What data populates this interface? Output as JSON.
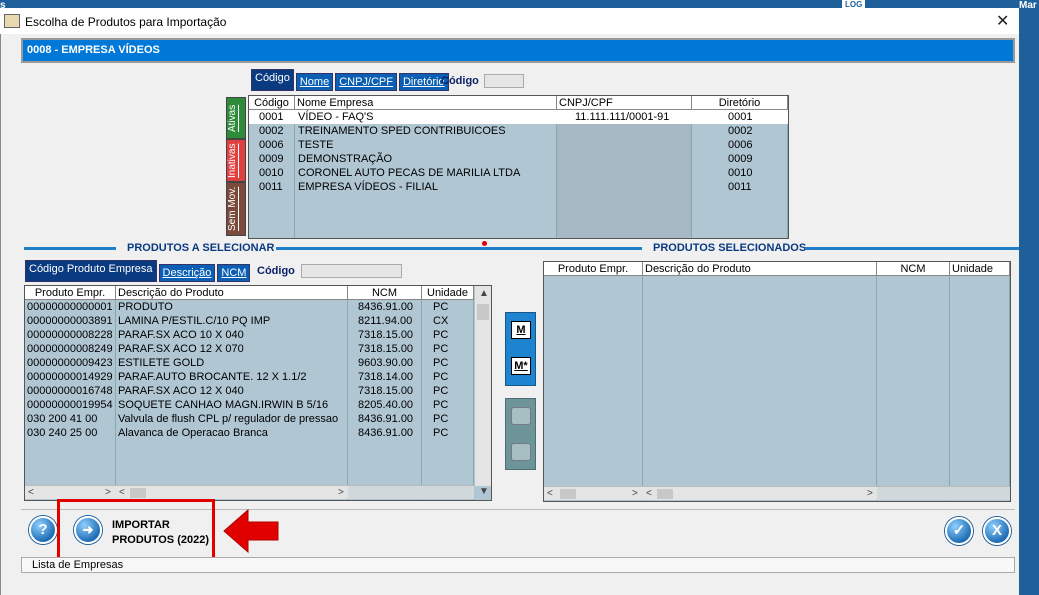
{
  "window": {
    "title": "Escolha de Produtos para Importação",
    "close_glyph": "✕",
    "topbar_left": "s",
    "topbar_right": "Mar",
    "topbar_log": "LOG"
  },
  "company_bar": "0008 - EMPRESA VÍDEOS",
  "company_tabs": {
    "tabs": [
      "Código",
      "Nome",
      "CNPJ/CPF",
      "Diretório"
    ],
    "search_label": "Código"
  },
  "company_vtabs": [
    "Ativas",
    "Inativas",
    "Sem Mov."
  ],
  "company_grid": {
    "headers": [
      "Código",
      "Nome Empresa",
      "CNPJ/CPF",
      "Diretório"
    ],
    "rows": [
      {
        "codigo": "0001",
        "nome": "VÍDEO - FAQ'S",
        "cnpj": "11.111.111/0001-91",
        "dir": "0001"
      },
      {
        "codigo": "0002",
        "nome": "TREINAMENTO SPED CONTRIBUICOES",
        "cnpj": "",
        "dir": "0002"
      },
      {
        "codigo": "0006",
        "nome": "TESTE",
        "cnpj": "",
        "dir": "0006"
      },
      {
        "codigo": "0009",
        "nome": "DEMONSTRAÇÃO",
        "cnpj": "",
        "dir": "0009"
      },
      {
        "codigo": "0010",
        "nome": "CORONEL AUTO PECAS DE MARILIA LTDA",
        "cnpj": "",
        "dir": "0010"
      },
      {
        "codigo": "0011",
        "nome": "EMPRESA VÍDEOS - FILIAL",
        "cnpj": "",
        "dir": "0011"
      }
    ]
  },
  "sections": {
    "left_title": "PRODUTOS A SELECIONAR",
    "right_title": "PRODUTOS SELECIONADOS"
  },
  "product_tabs": {
    "tabs": [
      "Código Produto Empresa",
      "Descrição",
      "NCM"
    ],
    "search_label": "Código"
  },
  "products_grid": {
    "headers": [
      "Produto Empr.",
      "Descrição do Produto",
      "NCM",
      "Unidade"
    ],
    "rows": [
      {
        "cod": "00000000000001",
        "desc": "PRODUTO",
        "ncm": "8436.91.00",
        "un": "PC"
      },
      {
        "cod": "00000000003891",
        "desc": "LAMINA P/ESTIL.C/10 PQ IMP",
        "ncm": "8211.94.00",
        "un": "CX"
      },
      {
        "cod": "00000000008228",
        "desc": "PARAF.SX ACO 10 X 040",
        "ncm": "7318.15.00",
        "un": "PC"
      },
      {
        "cod": "00000000008249",
        "desc": "PARAF.SX ACO 12 X 070",
        "ncm": "7318.15.00",
        "un": "PC"
      },
      {
        "cod": "00000000009423",
        "desc": "ESTILETE GOLD",
        "ncm": "9603.90.00",
        "un": "PC"
      },
      {
        "cod": "00000000014929",
        "desc": "PARAF.AUTO BROCANTE. 12 X 1.1/2",
        "ncm": "7318.14.00",
        "un": "PC"
      },
      {
        "cod": "00000000016748",
        "desc": "PARAF.SX ACO 12 X 040",
        "ncm": "7318.15.00",
        "un": "PC"
      },
      {
        "cod": "00000000019954",
        "desc": "SOQUETE CANHAO MAGN.IRWIN B 5/16",
        "ncm": "8205.40.00",
        "un": "PC"
      },
      {
        "cod": "030 200 41 00",
        "desc": "Valvula de flush CPL p/ regulador de pressao",
        "ncm": "8436.91.00",
        "un": "PC"
      },
      {
        "cod": "030 240 25 00",
        "desc": "Alavanca de Operacao Branca",
        "ncm": "8436.91.00",
        "un": "PC"
      }
    ]
  },
  "selected_grid": {
    "headers": [
      "Produto Empr.",
      "Descrição do Produto",
      "NCM",
      "Unidade"
    ]
  },
  "mid_buttons": [
    "M",
    "M*"
  ],
  "bottom": {
    "import_line1": "IMPORTAR",
    "import_line2": "PRODUTOS (2022)",
    "help_glyph": "?",
    "ok_glyph": "✓",
    "cancel_glyph": "X"
  },
  "status": "Lista de Empresas",
  "colors": {
    "accent": "#0078d7",
    "grid_bg": "#b0c6d3",
    "highlight_red": "#e00000",
    "vtab_ativas": "#2e8b3a",
    "vtab_inativas": "#e04040",
    "vtab_semmov": "#7a4a3a"
  }
}
